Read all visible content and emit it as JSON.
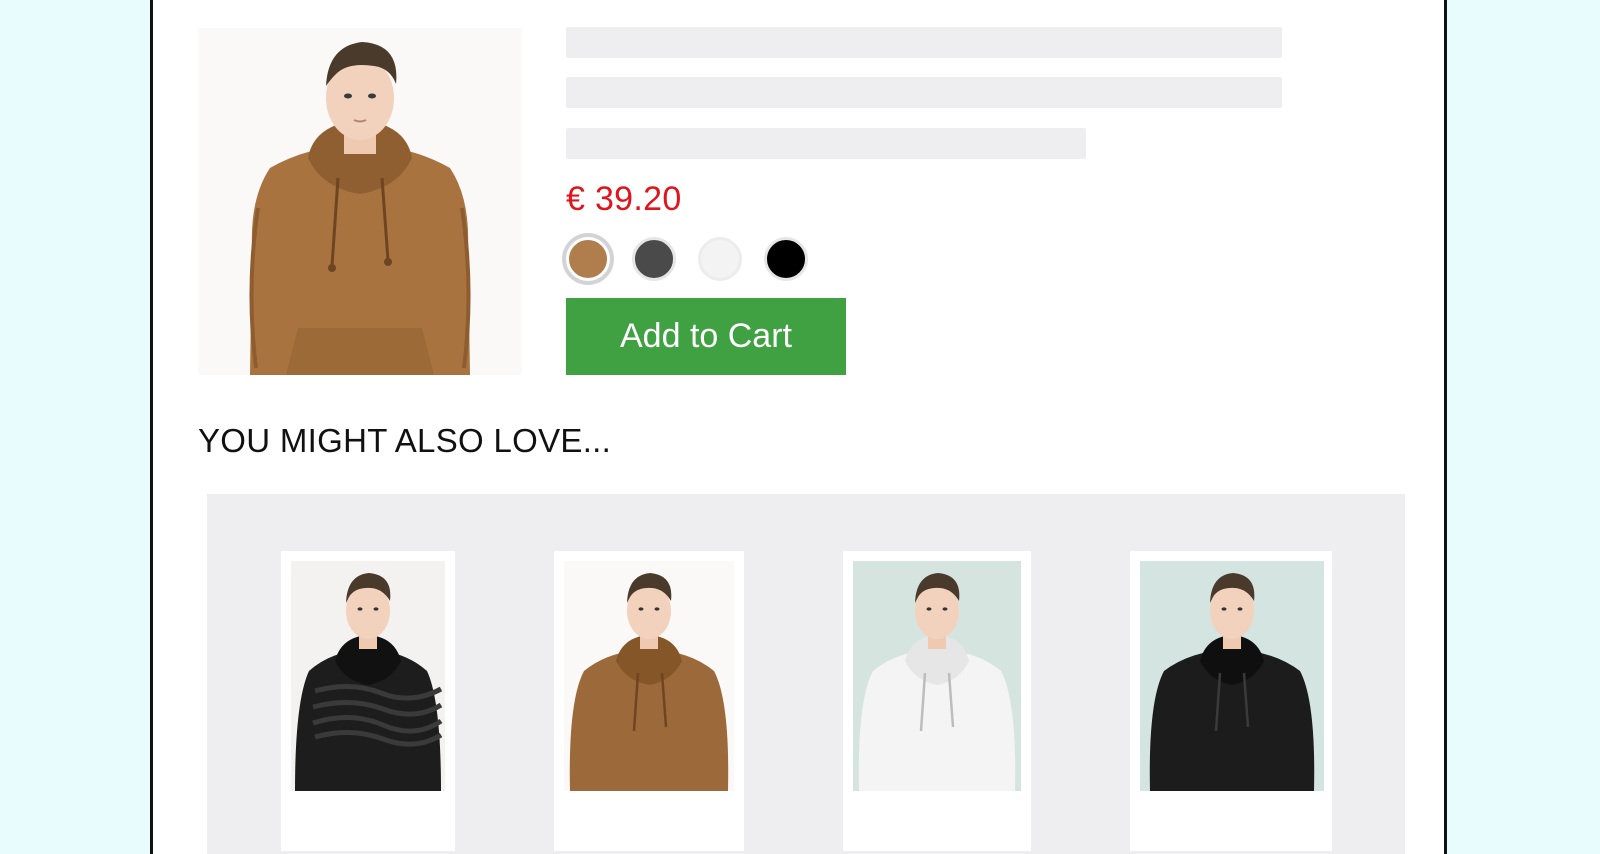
{
  "product": {
    "price": "€ 39.20",
    "add_to_cart_label": "Add to Cart",
    "swatches": [
      {
        "color": "#b07e4c",
        "selected": true
      },
      {
        "color": "#4a4a4a",
        "selected": false
      },
      {
        "color": "#f3f3f3",
        "selected": false
      },
      {
        "color": "#000000",
        "selected": false
      }
    ]
  },
  "recommendations": {
    "title": "YOU MIGHT ALSO LOVE...",
    "items": [
      {
        "hoodie_color": "#1d1d1d",
        "background": "#f4f2f0",
        "pattern": "zebra"
      },
      {
        "hoodie_color": "#9c6a3a",
        "background": "#fbf9f7",
        "pattern": "none"
      },
      {
        "hoodie_color": "#f4f4f4",
        "background": "#d6e4e0",
        "pattern": "none"
      },
      {
        "hoodie_color": "#1c1c1c",
        "background": "#d3e4e1",
        "pattern": "none"
      }
    ]
  },
  "colors": {
    "page_background": "#e9fcfd",
    "price": "#e2141b",
    "button": "#3fa142",
    "placeholder": "#eeedf0"
  }
}
